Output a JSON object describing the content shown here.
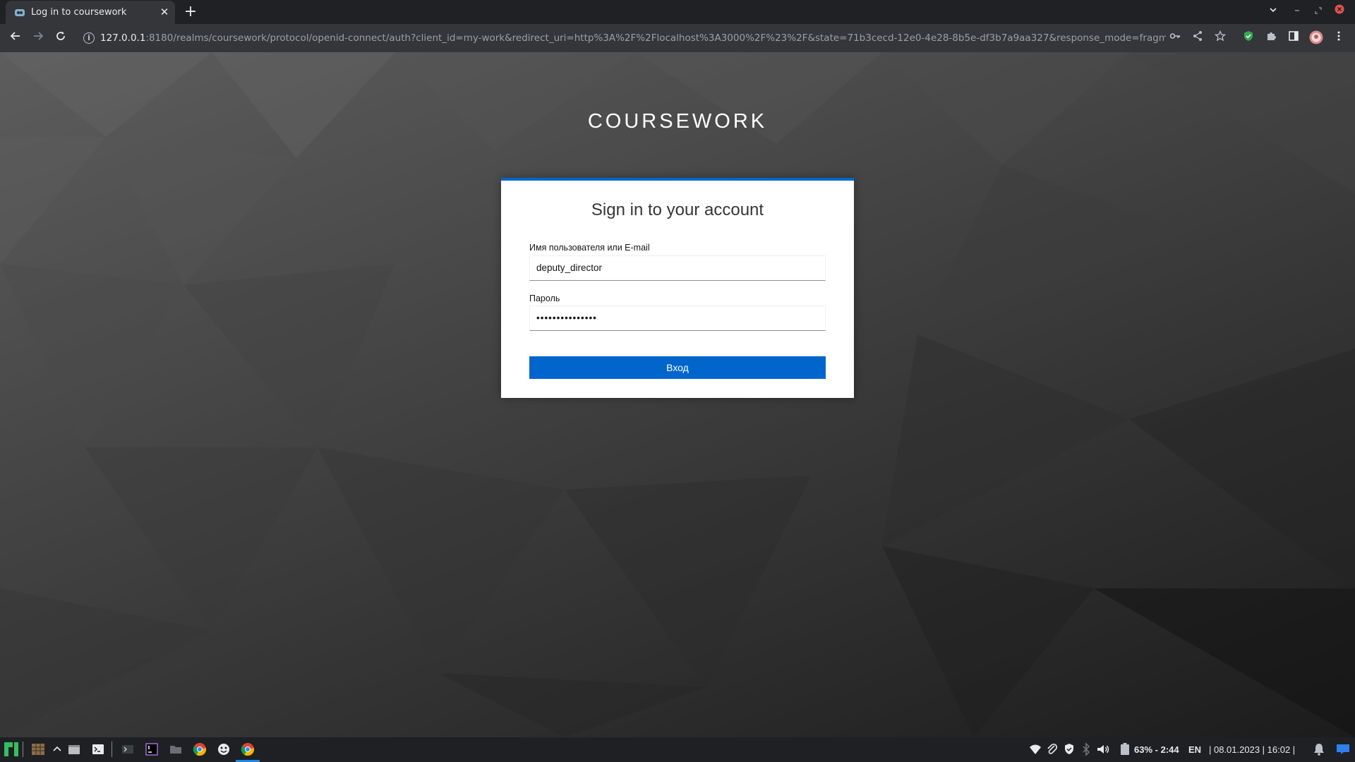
{
  "browser": {
    "tab": {
      "title": "Log in to coursework",
      "close": "✕"
    },
    "new_tab": "+",
    "url": {
      "host": "127.0.0.1",
      "rest": ":8180/realms/coursework/protocol/openid-connect/auth?client_id=my-work&redirect_uri=http%3A%2F%2Flocalhost%3A3000%2F%23%2F&state=71b3cecd-12e0-4e28-8b5e-df3b7a9aa327&response_mode=fragment..."
    },
    "icons": [
      "back-icon",
      "forward-icon",
      "reload-icon",
      "info-icon",
      "key-icon",
      "share-icon",
      "star-icon",
      "shield-extension-icon",
      "puzzle-icon",
      "side-panel-icon",
      "profile-avatar",
      "menu-icon"
    ]
  },
  "page": {
    "realm_title": "COURSEWORK",
    "card_title": "Sign in to your account",
    "username_label": "Имя пользователя или E-mail",
    "username_value": "deputy_director",
    "password_label": "Пароль",
    "password_value": "•••••••••••••••",
    "login_button": "Вход"
  },
  "taskbar": {
    "battery": "63% - 2:44",
    "lang": "EN",
    "datetime": "| 08.01.2023 | 16:02 |"
  },
  "colors": {
    "accent": "#0066cc",
    "card_bg": "#ffffff",
    "chrome_dark": "#202124",
    "chrome_toolbar": "#35363a",
    "taskbar_bg": "#1e2024"
  }
}
